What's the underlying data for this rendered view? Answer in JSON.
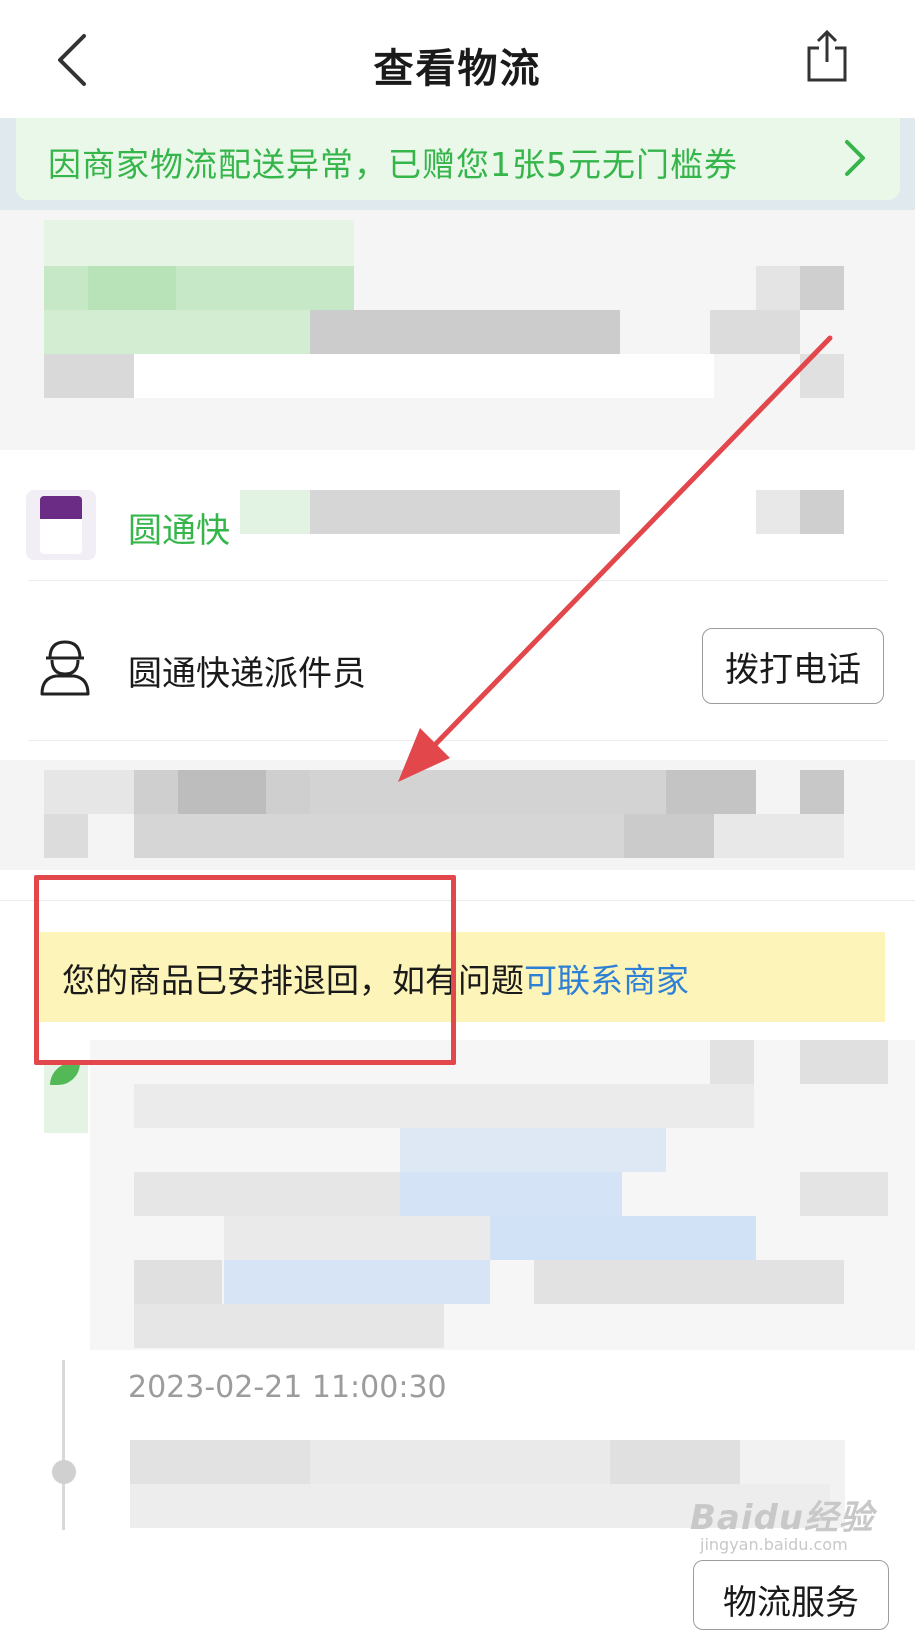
{
  "header": {
    "title": "查看物流",
    "back_icon": "chevron-left-icon",
    "share_icon": "share-icon"
  },
  "notice": {
    "text": "因商家物流配送异常，已赠您1张5元无门槛券",
    "arrow_icon": "chevron-right-icon",
    "color": "#35b54a"
  },
  "shipment": {
    "courier_name": "圆通快"
  },
  "courier": {
    "role": "圆通快递派件员",
    "call_label": "拨打电话",
    "avatar_icon": "courier-icon"
  },
  "return_notice": {
    "text": "您的商品已安排退回，如有问题",
    "link": "可联系商家",
    "link_color": "#2e7fd6"
  },
  "timeline": {
    "timestamp": "2023-02-21 11:00:30"
  },
  "footer": {
    "service_label": "物流服务"
  },
  "watermark": {
    "logo": "Baidu经验",
    "url": "jingyan.baidu.com"
  },
  "annotation": {
    "color": "#e2474c"
  }
}
